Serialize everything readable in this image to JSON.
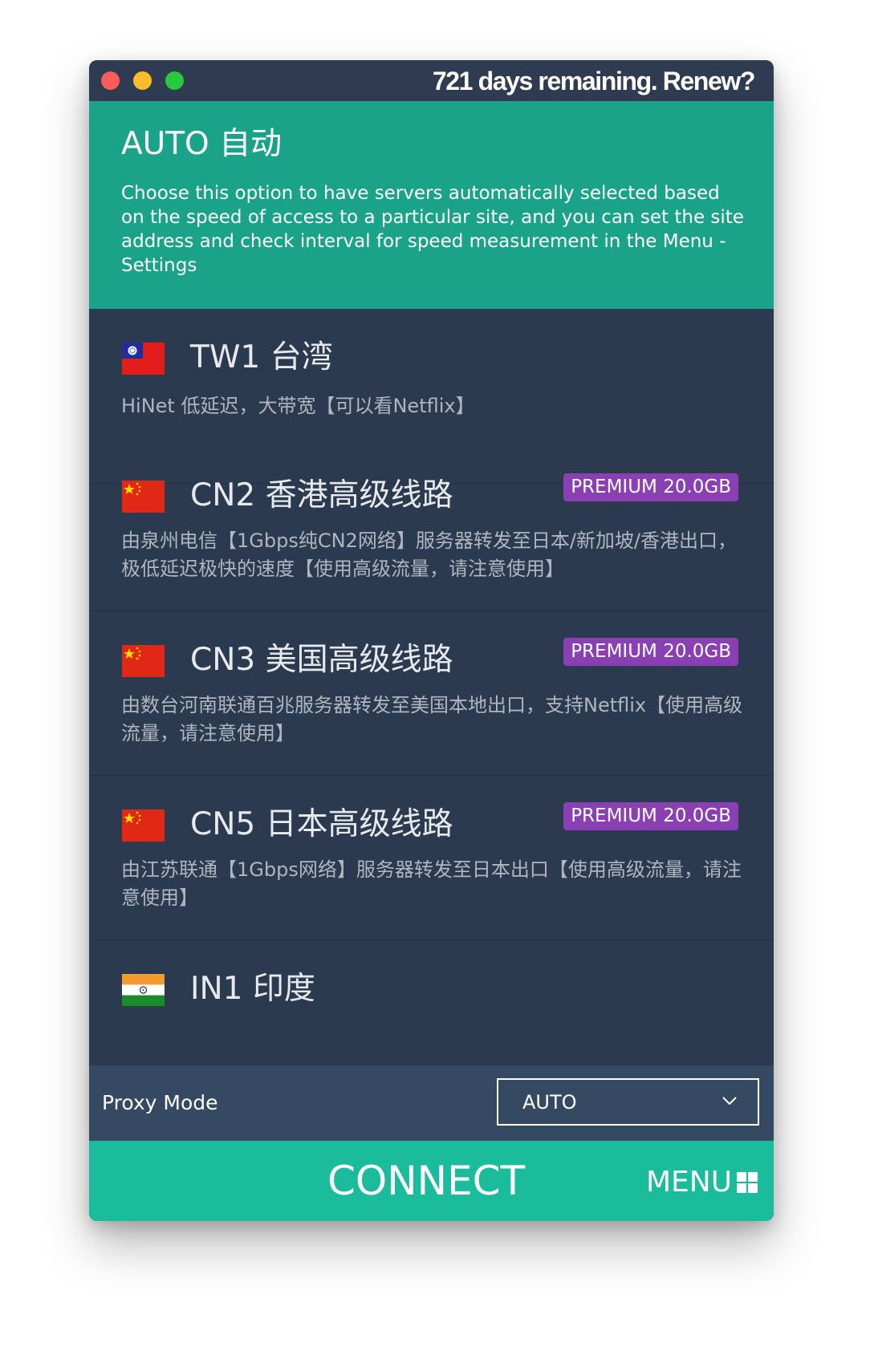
{
  "titlebar": {
    "renew_text": "721 days remaining. Renew?"
  },
  "auto": {
    "title": "AUTO 自动",
    "description": "Choose this option to have servers automatically selected based on the speed of access to a particular site, and you can set the site address and check interval for speed measurement in the Menu - Settings"
  },
  "servers": [
    {
      "name": "TW1 台湾",
      "flag": "taiwan-flag",
      "description": "HiNet 低延迟，大带宽【可以看Netflix】",
      "badge": ""
    },
    {
      "name": "CN2 香港高级线路",
      "flag": "china-flag",
      "description": "由泉州电信【1Gbps纯CN2网络】服务器转发至日本/新加坡/香港出口，极低延迟极快的速度【使用高级流量，请注意使用】",
      "badge": "PREMIUM 20.0GB"
    },
    {
      "name": "CN3 美国高级线路",
      "flag": "china-flag",
      "description": "由数台河南联通百兆服务器转发至美国本地出口，支持Netflix【使用高级流量，请注意使用】",
      "badge": "PREMIUM 20.0GB"
    },
    {
      "name": "CN5 日本高级线路",
      "flag": "china-flag",
      "description": "由江苏联通【1Gbps网络】服务器转发至日本出口【使用高级流量，请注意使用】",
      "badge": "PREMIUM 20.0GB"
    },
    {
      "name": "IN1 印度",
      "flag": "india-flag",
      "description": "",
      "badge": ""
    }
  ],
  "proxy": {
    "label": "Proxy Mode",
    "selected": "AUTO"
  },
  "footer": {
    "connect_label": "CONNECT",
    "menu_label": "MENU"
  },
  "colors": {
    "auto_panel": "#1ba389",
    "list_bg": "#2c3a4f",
    "proxy_bar": "#354a62",
    "connect_bar": "#1bbc9b",
    "premium_badge": "#8a3fb3"
  },
  "icons": {
    "dropdown": "chevron-down-icon",
    "menu": "grid-icon"
  }
}
